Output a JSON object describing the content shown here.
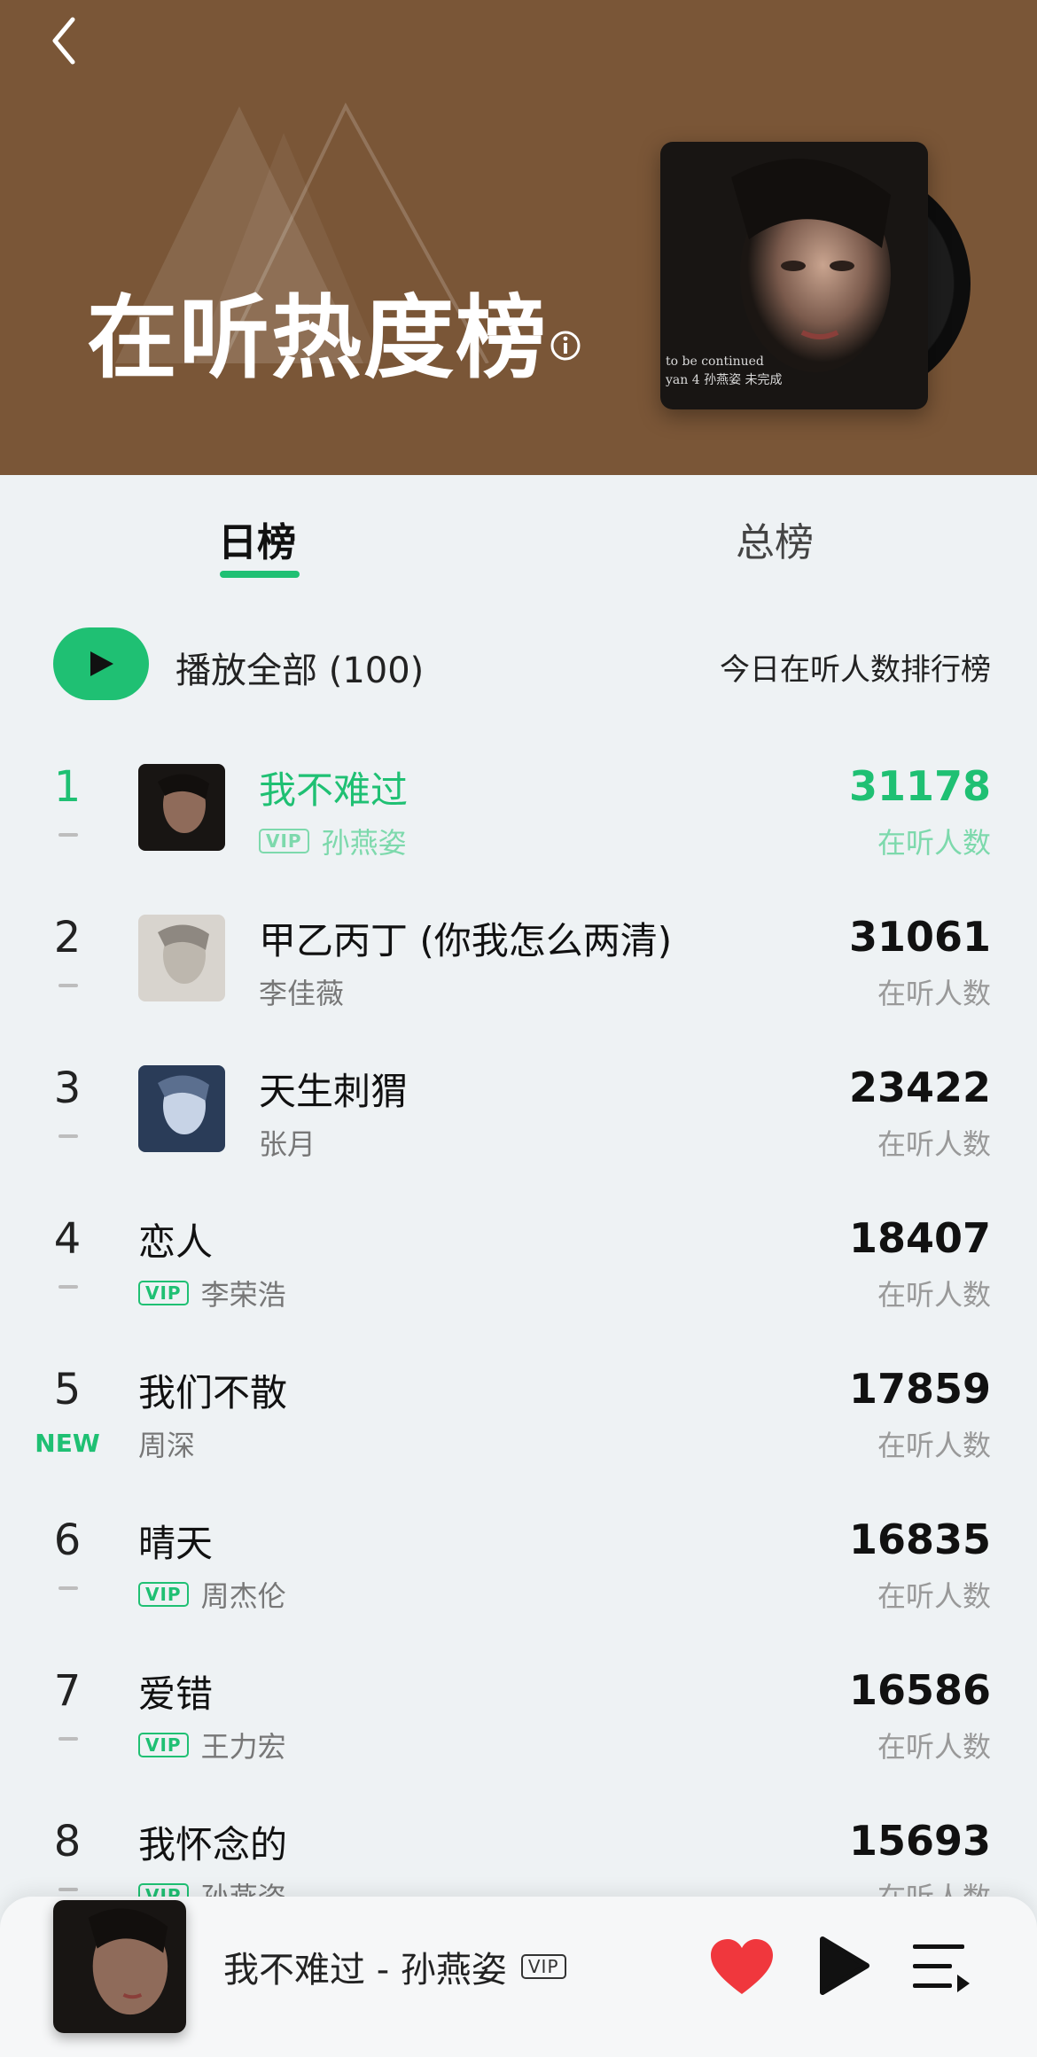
{
  "header": {
    "title": "在听热度榜",
    "album_caption_line1": "to be continued",
    "album_caption_line2": "yan 4 孙燕姿 未完成"
  },
  "tabs": [
    {
      "label": "日榜",
      "active": true
    },
    {
      "label": "总榜",
      "active": false
    }
  ],
  "play_all": {
    "label": "播放全部 (100)",
    "description": "今日在听人数排行榜"
  },
  "count_label": "在听人数",
  "songs": [
    {
      "rank": "1",
      "title": "我不难过",
      "artist": "孙燕姿",
      "vip": true,
      "count": "31178",
      "trend": "—",
      "has_cover": true
    },
    {
      "rank": "2",
      "title": "甲乙丙丁 (你我怎么两清)",
      "artist": "李佳薇",
      "vip": false,
      "count": "31061",
      "trend": "—",
      "has_cover": true
    },
    {
      "rank": "3",
      "title": "天生刺猬",
      "artist": "张月",
      "vip": false,
      "count": "23422",
      "trend": "—",
      "has_cover": true
    },
    {
      "rank": "4",
      "title": "恋人",
      "artist": "李荣浩",
      "vip": true,
      "count": "18407",
      "trend": "—",
      "has_cover": false
    },
    {
      "rank": "5",
      "title": "我们不散",
      "artist": "周深",
      "vip": false,
      "count": "17859",
      "trend": "NEW",
      "has_cover": false
    },
    {
      "rank": "6",
      "title": "晴天",
      "artist": "周杰伦",
      "vip": true,
      "count": "16835",
      "trend": "—",
      "has_cover": false
    },
    {
      "rank": "7",
      "title": "爱错",
      "artist": "王力宏",
      "vip": true,
      "count": "16586",
      "trend": "—",
      "has_cover": false
    },
    {
      "rank": "8",
      "title": "我怀念的",
      "artist": "孙燕姿",
      "vip": true,
      "count": "15693",
      "trend": "—",
      "has_cover": false
    }
  ],
  "vip_label": "VIP",
  "player": {
    "now_playing": "我不难过 - 孙燕姿",
    "vip_label": "VIP"
  },
  "colors": {
    "accent": "#1fc073",
    "banner": "#7a5637",
    "background": "#eef2f4",
    "heart": "#f0373d"
  }
}
